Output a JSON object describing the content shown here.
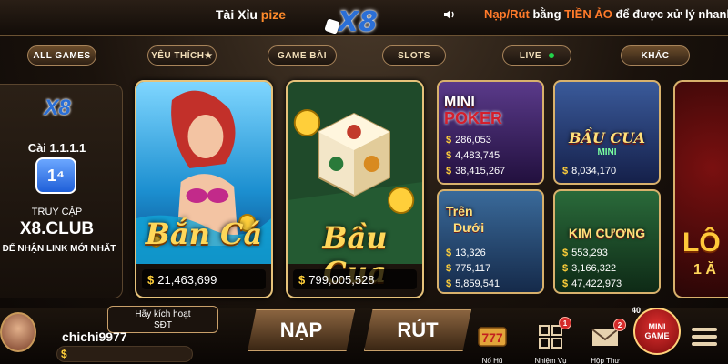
{
  "header": {
    "left_text_white": "Tài Xỉu",
    "left_text_accent": "pize",
    "logo_text": "X8",
    "ticker_part1": "Nạp/Rút",
    "ticker_part2": " bằng ",
    "ticker_part3": "TIỀN ẢO",
    "ticker_part4": " để được xử lý nhanh hơn"
  },
  "tabs": [
    {
      "label": "ALL GAMES"
    },
    {
      "label": "YÊU THÍCH★"
    },
    {
      "label": "GAME BÀI"
    },
    {
      "label": "SLOTS"
    },
    {
      "label": "LIVE"
    },
    {
      "label": "KHÁC"
    }
  ],
  "promo": {
    "logo": "X8",
    "cai": "Cài 1.1.1.1",
    "app_icon": "1⁴",
    "truy_cap": "TRUY CẬP",
    "club": "X8.CLUB",
    "link": "ĐỂ NHẬN LINK MỚI NHẤT"
  },
  "games": {
    "ban_ca": {
      "title": "Bắn Cá",
      "jackpot": "21,463,699"
    },
    "bau_cua": {
      "title": "Bầu Cua",
      "jackpot": "799,005,528"
    },
    "mini_poker": {
      "title": "MINI",
      "subtitle": "POKER",
      "jackpots": [
        "286,053",
        "4,483,745",
        "38,415,267"
      ]
    },
    "bau_cua_mini": {
      "title": "BẦU CUA",
      "subtitle": "MINI",
      "jackpots": [
        "8,034,170"
      ]
    },
    "tren_duoi": {
      "title": "Trên",
      "subtitle": "Dưới",
      "jackpots": [
        "13,326",
        "775,117",
        "5,859,541"
      ]
    },
    "kim_cuong": {
      "title": "KIM CƯƠNG",
      "jackpots": [
        "553,293",
        "3,166,322",
        "47,422,973"
      ]
    },
    "right_partial": {
      "title": "LÔ",
      "subtitle": "1 Ă"
    }
  },
  "coin_symbol": "$",
  "user": {
    "activate_line1": "Hãy kích hoạt",
    "activate_line2": "SĐT",
    "name": "chichi9977",
    "balance_symbol": "$"
  },
  "actions": {
    "nap": "NẠP",
    "rut": "RÚT"
  },
  "bottom_nav": [
    {
      "label": "Nổ Hũ",
      "icon": "slot-777-icon"
    },
    {
      "label": "Nhiệm Vụ",
      "icon": "gift-grid-icon",
      "badge": "1"
    },
    {
      "label": "Hộp Thư",
      "icon": "mail-icon",
      "badge": "2"
    }
  ],
  "minigame": {
    "count": "40",
    "line1": "MINI",
    "line2": "GAME"
  },
  "colors": {
    "accent": "#ff8a2a",
    "gold": "#ffd75a",
    "border": "#d8b16c",
    "live": "#22d34a"
  }
}
